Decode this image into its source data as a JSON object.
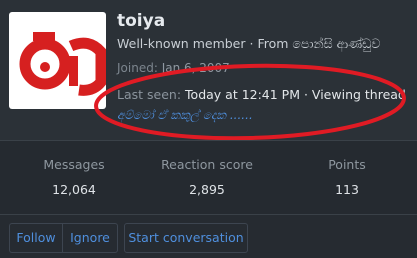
{
  "profile": {
    "username": "toiya",
    "title": "Well-known member",
    "from_separator": " · ",
    "from_label": "From",
    "location": "පොන්සි ආණ්ඩුව",
    "joined_label": "Joined:",
    "joined_value": "Jan 6, 2007",
    "last_seen_label": "Last seen:",
    "last_seen_value": "Today at 12:41 PM · Viewing thread",
    "status_text": "අම්මෝ ඒ කකුල් දෙක ......",
    "avatar_text": "ටි"
  },
  "stats": [
    {
      "label": "Messages",
      "value": "12,064"
    },
    {
      "label": "Reaction score",
      "value": "2,895"
    },
    {
      "label": "Points",
      "value": "113"
    }
  ],
  "actions": {
    "follow": "Follow",
    "ignore": "Ignore",
    "start_conversation": "Start conversation"
  },
  "colors": {
    "accent": "#4f8fdd",
    "annotation": "#e01b24",
    "avatar_glyph": "#d62020"
  }
}
